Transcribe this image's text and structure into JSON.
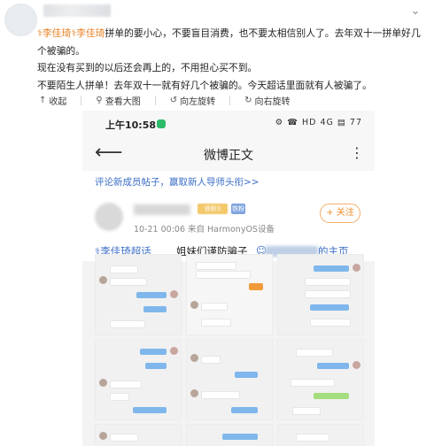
{
  "post": {
    "paragraphs": [
      {
        "topics": [
          "李佳琦",
          "李佳琦"
        ],
        "text": "拼单的要小心，不要盲目消费，也不要太相信别人了。去年双十一拼单好几个被骗的。"
      },
      {
        "text": "现在没有买到的以后还会再上的，不用担心买不到。"
      },
      {
        "text": "不要陌生人拼单！去年双十一就有好几个被骗的。今天超话里面就有人被骗了。"
      }
    ],
    "topic_marker": "⚕"
  },
  "toolbar": {
    "collapse": "收起",
    "view_large": "查看大图",
    "rotate_left": "向左旋转",
    "rotate_right": "向右旋转"
  },
  "screenshot": {
    "status_time": "上午10:58",
    "status_right": "⚙ ☎ HD 4G ▤ 77",
    "nav_title": "微博正文",
    "banner": "评论新成员帖子，赢取新人导师头衔>>",
    "badge_1": "铁粉3",
    "badge_2": "铁粉",
    "author_meta": "10-21 00:06  来自 HarmonyOS设备",
    "follow": "+ 关注",
    "topic": "李佳琦超话",
    "headline": "姐妹们谨防骗子",
    "tail": "的主页"
  },
  "colors": {
    "topic": "#e8842a",
    "link": "#3a6dc6",
    "follow": "#f08c2a"
  }
}
